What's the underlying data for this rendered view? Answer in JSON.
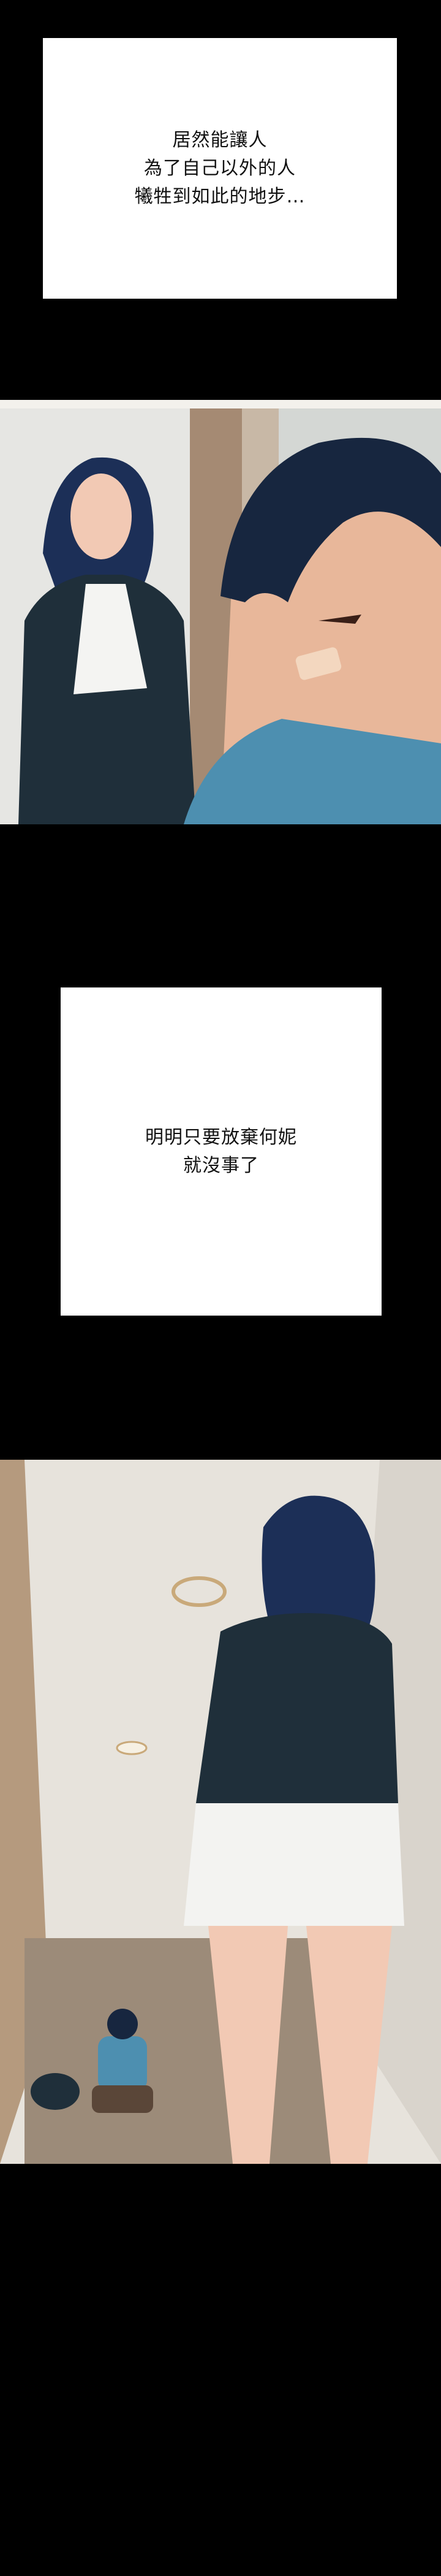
{
  "captions": {
    "first": "居然能讓人\n為了自己以外的人\n犧牲到如此的地步…",
    "second": "明明只要放棄何妮\n就沒事了"
  },
  "colors": {
    "background": "#000000",
    "caption_box": "#ffffff",
    "caption_text": "#111111",
    "hair": "#1c2f57",
    "jacket": "#1f2f3a",
    "skin": "#f2c9b4",
    "shirt": "#4d8fb0"
  }
}
